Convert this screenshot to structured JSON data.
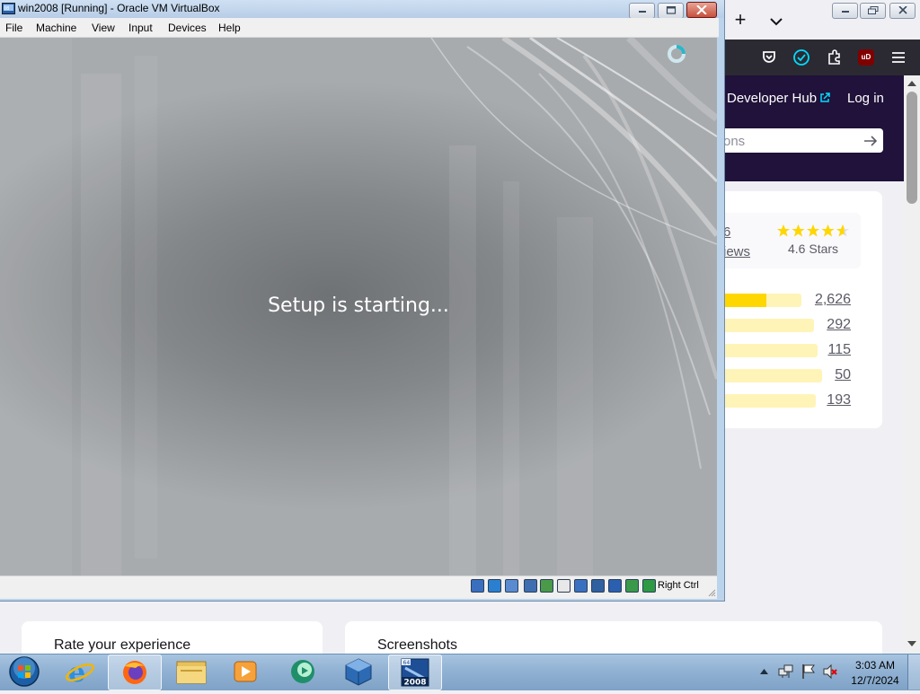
{
  "firefox": {
    "new_tab": "+",
    "tab_list": "⌄",
    "toolbar_icons": [
      "pocket-icon",
      "check-icon",
      "extensions-icon",
      "ublock-icon",
      "menu-icon"
    ],
    "ublock_badge": "uD",
    "header": {
      "developer_hub": "Developer Hub",
      "log_in": "Log in"
    },
    "search_placeholder": "ons",
    "reviews": {
      "count_fragment": "6",
      "label_fragment": "iews",
      "stars_value": 4.6,
      "stars_label": "4.6 Stars",
      "bars": [
        {
          "count": "2,626",
          "fill": 0.55
        },
        {
          "count": "292",
          "fill": 0.0
        },
        {
          "count": "115",
          "fill": 0.0
        },
        {
          "count": "50",
          "fill": 0.0
        },
        {
          "count": "193",
          "fill": 0.0
        }
      ]
    },
    "lower_cards": [
      "Rate your experience",
      "Screenshots"
    ]
  },
  "vbox": {
    "title": "win2008 [Running] - Oracle VM VirtualBox",
    "menu": [
      "File",
      "Machine",
      "View",
      "Input",
      "Devices",
      "Help"
    ],
    "screen_text": "Setup is starting...",
    "host_key": "Right Ctrl"
  },
  "taskbar": {
    "apps": [
      "start-orb",
      "internet-explorer",
      "firefox",
      "windows-explorer",
      "media-player",
      "green-app",
      "virtualbox",
      "win2008-vm"
    ],
    "vm_badge": "2008",
    "vm_badge_top": "64",
    "time": "3:03 AM",
    "date": "12/7/2024"
  },
  "colors": {
    "purple_header": "#20123a",
    "star": "#ffd700",
    "bar_bg": "#fff4b8",
    "taskbar": "#8fb0d2"
  }
}
